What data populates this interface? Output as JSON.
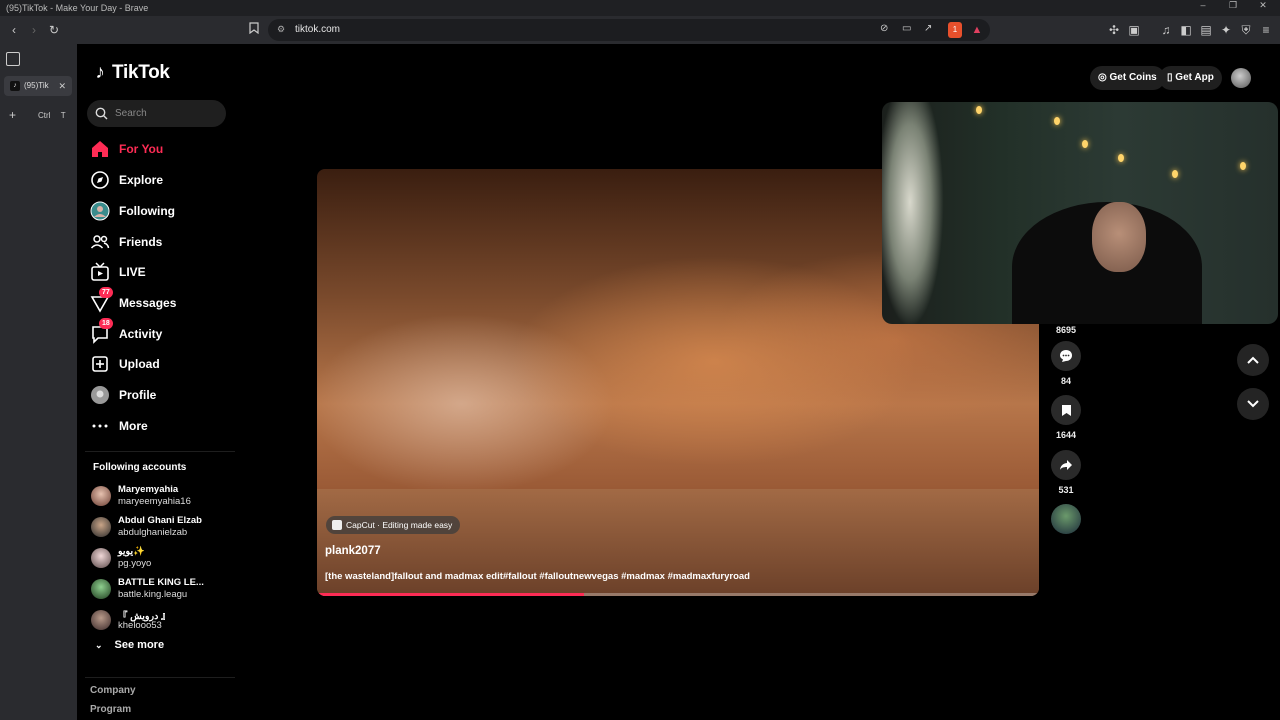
{
  "browser": {
    "window_title": "(95)TikTok - Make Your Day - Brave",
    "url": "tiktok.com",
    "tab_title": "(95)Tik",
    "new_tab_hint": "Ctrl",
    "new_tab_key": "T",
    "shield_count": "1"
  },
  "app": {
    "logo": "TikTok",
    "search_placeholder": "Search",
    "accent_color": "#fe2c55"
  },
  "nav": [
    {
      "label": "For You",
      "icon": "home-icon",
      "active": true
    },
    {
      "label": "Explore",
      "icon": "compass-icon"
    },
    {
      "label": "Following",
      "icon": "following-icon"
    },
    {
      "label": "Friends",
      "icon": "friends-icon"
    },
    {
      "label": "LIVE",
      "icon": "live-icon"
    },
    {
      "label": "Messages",
      "icon": "messages-icon",
      "badge": "77"
    },
    {
      "label": "Activity",
      "icon": "activity-icon",
      "badge": "18"
    },
    {
      "label": "Upload",
      "icon": "upload-icon"
    },
    {
      "label": "Profile",
      "icon": "profile-icon"
    },
    {
      "label": "More",
      "icon": "more-icon"
    }
  ],
  "following": {
    "header": "Following accounts",
    "accounts": [
      {
        "name": "Maryemyahia",
        "handle": "maryeemyahia16"
      },
      {
        "name": "Abdul Ghani Elzab",
        "handle": "abdulghanielzab"
      },
      {
        "name": "يويو✨",
        "handle": "pg.yoyo"
      },
      {
        "name": "BATTLE KING LE...",
        "handle": "battle.king.leagu"
      },
      {
        "name": "『 درويش 』",
        "handle": "khelooo53"
      }
    ],
    "see_more": "See more"
  },
  "footer": [
    "Company",
    "Program"
  ],
  "topbar": {
    "get_coins": "Get Coins",
    "get_app": "Get App"
  },
  "video": {
    "capcut_label": "CapCut · Editing made easy",
    "author": "plank2077",
    "description": "[the wasteland]fallout and madmax edit#fallout #falloutnewvegas #madmax #madmaxfuryroad",
    "progress": 0.37
  },
  "actions": {
    "likes": "8695",
    "comments": "84",
    "saves": "1644",
    "shares": "531"
  }
}
